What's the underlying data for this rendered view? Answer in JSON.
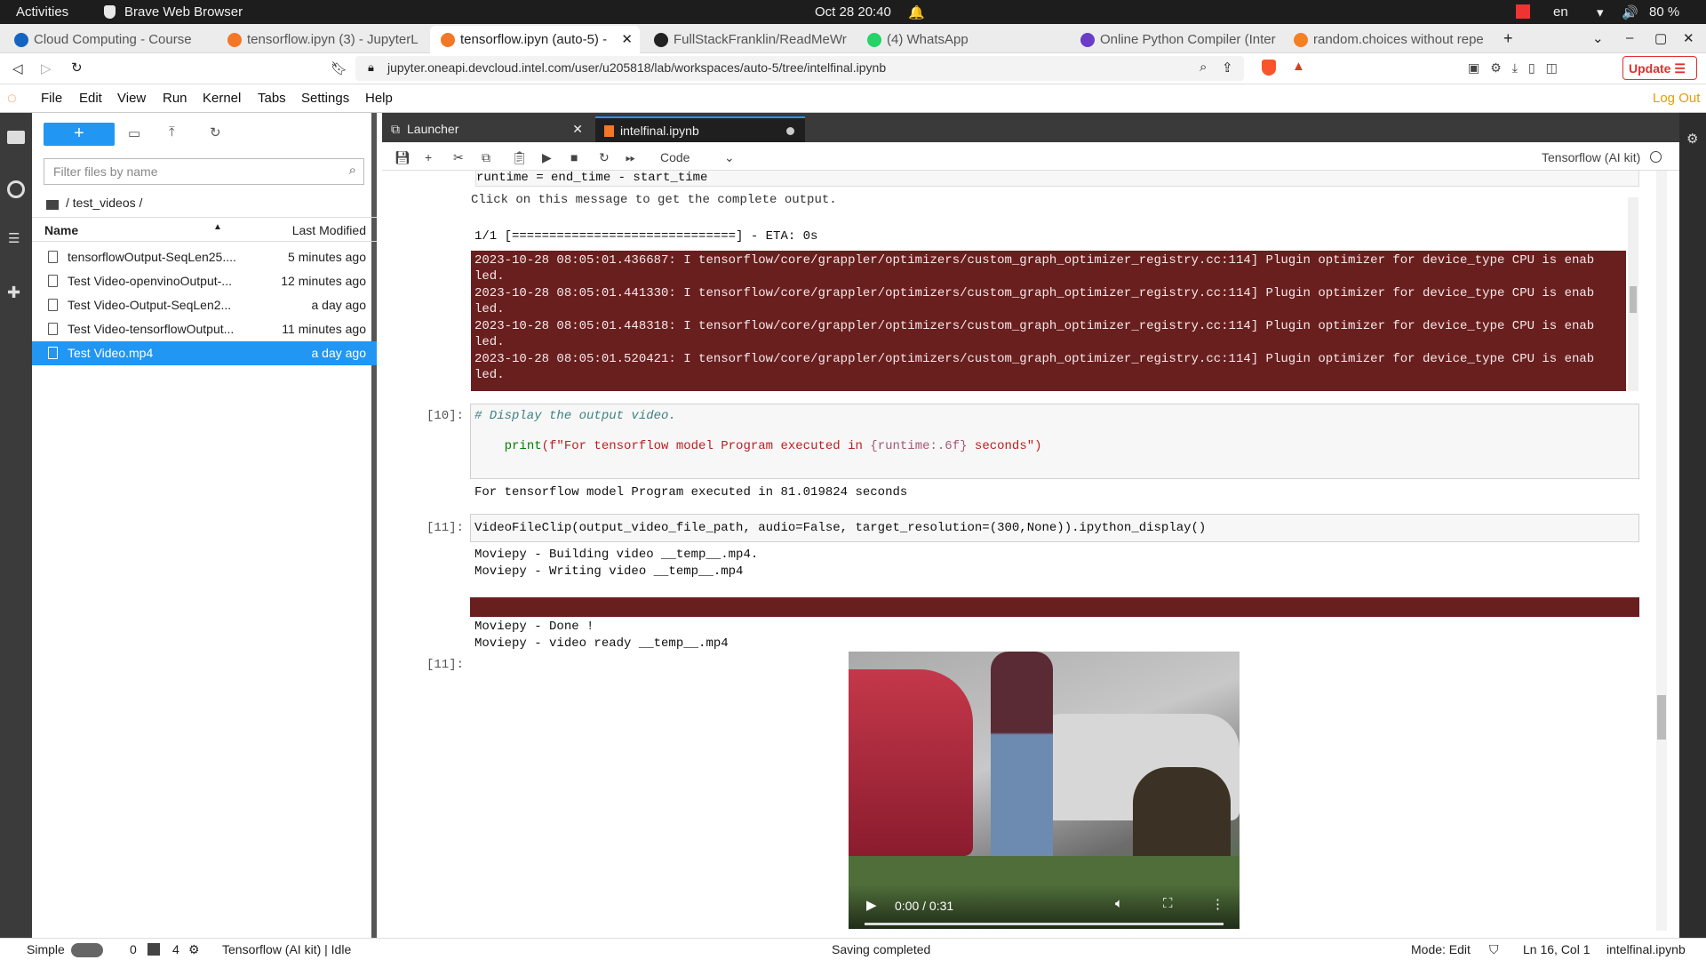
{
  "system": {
    "activities": "Activities",
    "app_name": "Brave Web Browser",
    "datetime": "Oct 28  20:40",
    "language": "en",
    "battery": "80 %"
  },
  "browser_tabs": [
    {
      "label": "Cloud Computing - Course"
    },
    {
      "label": "tensorflow.ipyn (3) - JupyterL"
    },
    {
      "label": "tensorflow.ipyn (auto-5) -"
    },
    {
      "label": "FullStackFranklin/ReadMeWr"
    },
    {
      "label": "(4) WhatsApp"
    },
    {
      "label": "Online Python Compiler (Inter"
    },
    {
      "label": "random.choices without repe"
    }
  ],
  "address": {
    "url": "jupyter.oneapi.devcloud.intel.com/user/u205818/lab/workspaces/auto-5/tree/intelfinal.ipynb",
    "update_label": "Update"
  },
  "jupyter_menu": [
    "File",
    "Edit",
    "View",
    "Run",
    "Kernel",
    "Tabs",
    "Settings",
    "Help"
  ],
  "logout": "Log Out",
  "file_browser": {
    "filter_placeholder": "Filter files by name",
    "path": "/ test_videos /",
    "col_name": "Name",
    "col_modified": "Last Modified",
    "files": [
      {
        "name": "tensorflowOutput-SeqLen25....",
        "modified": "5 minutes ago"
      },
      {
        "name": "Test Video-openvinoOutput-...",
        "modified": "12 minutes ago"
      },
      {
        "name": "Test Video-Output-SeqLen2...",
        "modified": "a day ago"
      },
      {
        "name": "Test Video-tensorflowOutput...",
        "modified": "11 minutes ago"
      },
      {
        "name": "Test Video.mp4",
        "modified": "a day ago"
      }
    ]
  },
  "doc_tabs": {
    "launcher": "Launcher",
    "notebook": "intelfinal.ipynb"
  },
  "toolbar": {
    "cell_type": "Code",
    "kernel": "Tensorflow (AI kit)"
  },
  "notebook": {
    "runtime_line": "runtime = end_time - start_time",
    "truncated_msg": "Click on this message to get the complete output.",
    "progress": "1/1 [==============================] - ETA: 0s",
    "errors": [
      "2023-10-28 08:05:01.436687: I tensorflow/core/grappler/optimizers/custom_graph_optimizer_registry.cc:114] Plugin optimizer for device_type CPU is enab\nled.",
      "2023-10-28 08:05:01.441330: I tensorflow/core/grappler/optimizers/custom_graph_optimizer_registry.cc:114] Plugin optimizer for device_type CPU is enab\nled.",
      "2023-10-28 08:05:01.448318: I tensorflow/core/grappler/optimizers/custom_graph_optimizer_registry.cc:114] Plugin optimizer for device_type CPU is enab\nled.",
      "2023-10-28 08:05:01.520421: I tensorflow/core/grappler/optimizers/custom_graph_optimizer_registry.cc:114] Plugin optimizer for device_type CPU is enab\nled."
    ],
    "cell10_prompt": "[10]:",
    "cell10_comment": "# Display the output video.",
    "cell10_print": "print",
    "cell10_str": "(f\"For tensorflow model Program executed in ",
    "cell10_fmt": "{runtime:.6f}",
    "cell10_end": " seconds\")",
    "cell10_output": "For tensorflow model Program executed in 81.019824 seconds",
    "cell11_prompt": "[11]:",
    "cell11_code": "VideoFileClip(output_video_file_path, audio=False, target_resolution=(300,None)).ipython_display()",
    "moviepy_1": "Moviepy - Building video __temp__.mp4.",
    "moviepy_2": "Moviepy - Writing video __temp__.mp4",
    "moviepy_3": "Moviepy - Done !",
    "moviepy_4": "Moviepy - video ready __temp__.mp4",
    "out11_prompt": "[11]:",
    "video_time": "0:00 / 0:31"
  },
  "statusbar": {
    "mode": "Simple",
    "n0": "0",
    "n4": "4",
    "kernel_status": "Tensorflow (AI kit) | Idle",
    "saving": "Saving completed",
    "edit_mode": "Mode: Edit",
    "position": "Ln 16, Col 1",
    "filename": "intelfinal.ipynb"
  }
}
